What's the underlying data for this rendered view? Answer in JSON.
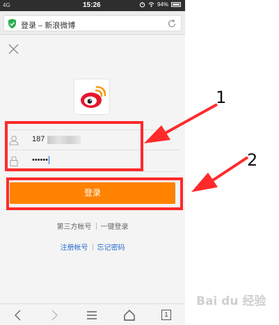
{
  "status_bar": {
    "carrier": "4G",
    "time": "15:26",
    "battery": "94%"
  },
  "browser": {
    "page_title": "登录 – 新浪微博"
  },
  "login": {
    "username_value": "187",
    "password_value": "••••••",
    "login_button": "登录",
    "third_party_label": "第三方帐号",
    "one_click_login": "一键登录",
    "register_link": "注册帐号",
    "forgot_password_link": "忘记密码"
  },
  "bottom_nav": {
    "tab_count": "1"
  },
  "annotations": {
    "label_1": "1",
    "label_2": "2",
    "color": "#ff2a2a"
  },
  "watermark": {
    "text": "Bai du 经验"
  },
  "colors": {
    "accent": "#ff8200",
    "link": "#2a6dd0",
    "annotation": "#ff2a2a"
  }
}
